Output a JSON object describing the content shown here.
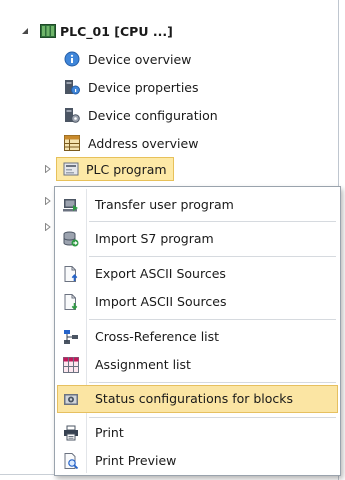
{
  "tree": {
    "root": {
      "label": "PLC_01 [CPU ...]",
      "icon": "plc-station-icon"
    },
    "children": [
      {
        "label": "Device overview",
        "icon": "info-circle-icon"
      },
      {
        "label": "Device properties",
        "icon": "device-properties-icon"
      },
      {
        "label": "Device configuration",
        "icon": "device-configuration-icon"
      },
      {
        "label": "Address overview",
        "icon": "address-table-icon"
      },
      {
        "label": "PLC program",
        "icon": "program-folder-icon",
        "selected": true
      }
    ]
  },
  "context_menu": {
    "items": [
      {
        "label": "Transfer user program",
        "icon": "transfer-icon"
      },
      {
        "label": "Import S7 program",
        "icon": "import-database-icon"
      },
      {
        "label": "Export ASCII Sources",
        "icon": "export-document-icon"
      },
      {
        "label": "Import ASCII Sources",
        "icon": "import-document-icon"
      },
      {
        "label": "Cross-Reference list",
        "icon": "cross-reference-icon"
      },
      {
        "label": "Assignment list",
        "icon": "assignment-grid-icon"
      },
      {
        "label": "Status configurations for blocks",
        "icon": "status-config-icon",
        "highlighted": true
      },
      {
        "label": "Print",
        "icon": "printer-icon"
      },
      {
        "label": "Print Preview",
        "icon": "print-preview-icon"
      }
    ]
  },
  "colors": {
    "highlight_fill": "#fbe5a3",
    "highlight_border": "#e6c060",
    "menu_border": "#9aa3ad"
  }
}
